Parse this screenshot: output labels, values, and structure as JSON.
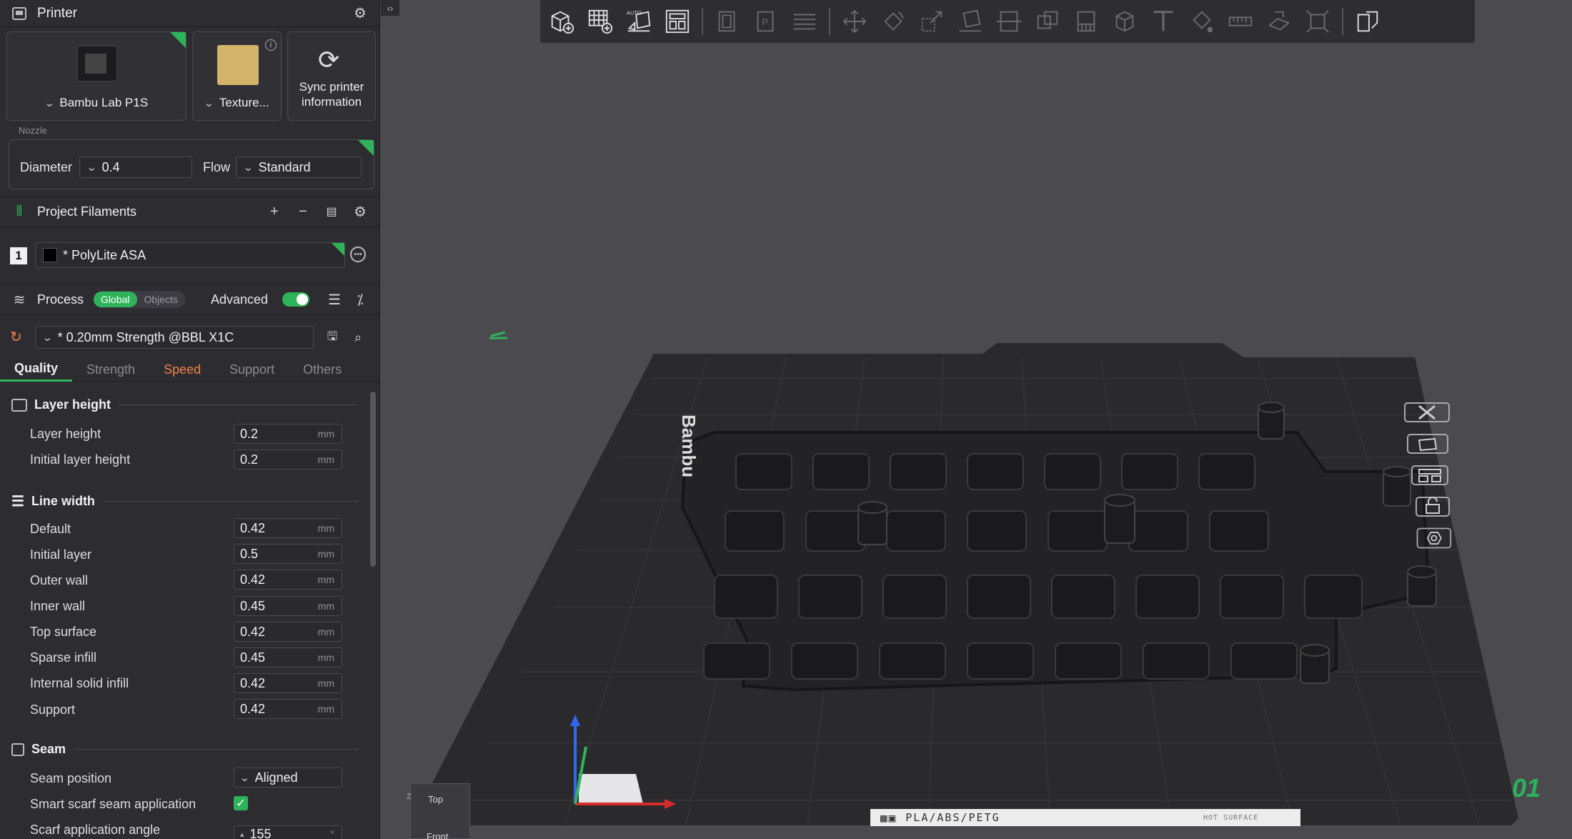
{
  "printer": {
    "title": "Printer",
    "model": "Bambu Lab P1S",
    "plate": "Texture...",
    "sync_label_1": "Sync printer",
    "sync_label_2": "information"
  },
  "nozzle": {
    "section_label": "Nozzle",
    "diameter_label": "Diameter",
    "diameter_value": "0.4",
    "flow_label": "Flow",
    "flow_value": "Standard"
  },
  "filaments": {
    "title": "Project Filaments",
    "items": [
      {
        "index": "1",
        "name": "* PolyLite ASA",
        "color": "#000000"
      }
    ]
  },
  "process": {
    "title": "Process",
    "scope_global": "Global",
    "scope_objects": "Objects",
    "advanced_label": "Advanced",
    "preset": "* 0.20mm Strength @BBL X1C"
  },
  "tabs": [
    {
      "label": "Quality",
      "state": "active"
    },
    {
      "label": "Strength",
      "state": "normal"
    },
    {
      "label": "Speed",
      "state": "highlight"
    },
    {
      "label": "Support",
      "state": "normal"
    },
    {
      "label": "Others",
      "state": "normal"
    }
  ],
  "settings": {
    "layer_height_group": "Layer height",
    "layer_height": {
      "label": "Layer height",
      "value": "0.2",
      "unit": "mm"
    },
    "initial_layer_height": {
      "label": "Initial layer height",
      "value": "0.2",
      "unit": "mm"
    },
    "line_width_group": "Line width",
    "line_widths": [
      {
        "label": "Default",
        "value": "0.42",
        "unit": "mm"
      },
      {
        "label": "Initial layer",
        "value": "0.5",
        "unit": "mm"
      },
      {
        "label": "Outer wall",
        "value": "0.42",
        "unit": "mm"
      },
      {
        "label": "Inner wall",
        "value": "0.45",
        "unit": "mm"
      },
      {
        "label": "Top surface",
        "value": "0.42",
        "unit": "mm"
      },
      {
        "label": "Sparse infill",
        "value": "0.45",
        "unit": "mm"
      },
      {
        "label": "Internal solid infill",
        "value": "0.42",
        "unit": "mm"
      },
      {
        "label": "Support",
        "value": "0.42",
        "unit": "mm"
      }
    ],
    "seam_group": "Seam",
    "seam_position": {
      "label": "Seam position",
      "value": "Aligned"
    },
    "smart_scarf": {
      "label": "Smart scarf seam application",
      "checked": true
    },
    "scarf_angle": {
      "label": "Scarf application angle",
      "value": "155",
      "unit": "°"
    }
  },
  "viewport": {
    "plate_text": "PLA/ABS/PETG",
    "hot_surface": "HOT SURFACE",
    "plate_number": "01",
    "nav_top": "Top",
    "nav_front": "Front",
    "nav_axis": "Z"
  },
  "colors": {
    "accent": "#2fb35a",
    "highlight": "#f0804a",
    "panel_bg": "#2d2d31",
    "viewport_bg": "#4b4b4f"
  }
}
